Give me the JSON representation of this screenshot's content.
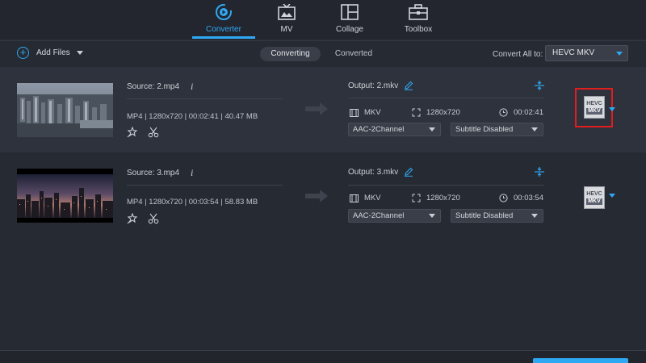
{
  "nav": {
    "tabs": [
      {
        "label": "Converter",
        "icon": "converter-icon",
        "active": true
      },
      {
        "label": "MV",
        "icon": "mv-icon",
        "active": false
      },
      {
        "label": "Collage",
        "icon": "collage-icon",
        "active": false
      },
      {
        "label": "Toolbox",
        "icon": "toolbox-icon",
        "active": false
      }
    ]
  },
  "toolbar": {
    "add_files_label": "Add Files",
    "converting_label": "Converting",
    "converted_label": "Converted",
    "convert_all_label": "Convert All to:",
    "convert_all_value": "HEVC MKV"
  },
  "files": [
    {
      "source": "Source: 2.mp4",
      "meta": "MP4 | 1280x720 | 00:02:41 | 40.47 MB",
      "output": "Output: 2.mkv",
      "format": "MKV",
      "resolution": "1280x720",
      "duration": "00:02:41",
      "audio": "AAC-2Channel",
      "subtitle": "Subtitle Disabled",
      "format_badge_top": "HEVC",
      "format_badge_bottom": "MKV"
    },
    {
      "source": "Source: 3.mp4",
      "meta": "MP4 | 1280x720 | 00:03:54 | 58.83 MB",
      "output": "Output: 3.mkv",
      "format": "MKV",
      "resolution": "1280x720",
      "duration": "00:03:54",
      "audio": "AAC-2Channel",
      "subtitle": "Subtitle Disabled",
      "format_badge_top": "HEVC",
      "format_badge_bottom": "MKV"
    }
  ],
  "colors": {
    "accent": "#2fa8f3",
    "highlight": "#e01e1e",
    "background": "#262a33"
  }
}
